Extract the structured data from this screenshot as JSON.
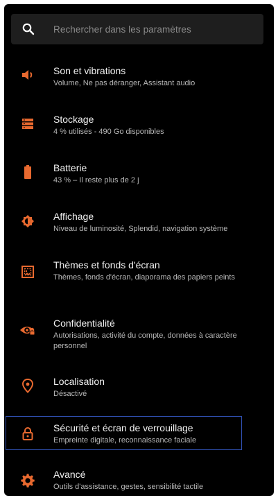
{
  "search": {
    "placeholder": "Rechercher dans les paramètres"
  },
  "accent_color": "#e8692f",
  "items": [
    {
      "title": "Son et vibrations",
      "subtitle": "Volume, Ne pas déranger, Assistant audio",
      "icon": "speaker-icon"
    },
    {
      "title": "Stockage",
      "subtitle": "4 % utilisés - 490 Go disponibles",
      "icon": "storage-icon"
    },
    {
      "title": "Batterie",
      "subtitle": "43 % – Il reste plus de 2 j",
      "icon": "battery-icon"
    },
    {
      "title": "Affichage",
      "subtitle": "Niveau de luminosité, Splendid, navigation système",
      "icon": "brightness-icon"
    },
    {
      "title": "Thèmes et fonds d'écran",
      "subtitle": "Thèmes, fonds d'écran, diaporama des papiers peints",
      "icon": "wallpaper-icon"
    },
    {
      "title": "Confidentialité",
      "subtitle": "Autorisations, activité du compte, données à caractère personnel",
      "icon": "privacy-eye-icon"
    },
    {
      "title": "Localisation",
      "subtitle": "Désactivé",
      "icon": "location-pin-icon"
    },
    {
      "title": "Sécurité et écran de verrouillage",
      "subtitle": "Empreinte digitale, reconnaissance faciale",
      "icon": "lock-icon",
      "selected": true
    },
    {
      "title": "Avancé",
      "subtitle": "Outils d'assistance, gestes, sensibilité tactile",
      "icon": "gear-icon"
    }
  ]
}
